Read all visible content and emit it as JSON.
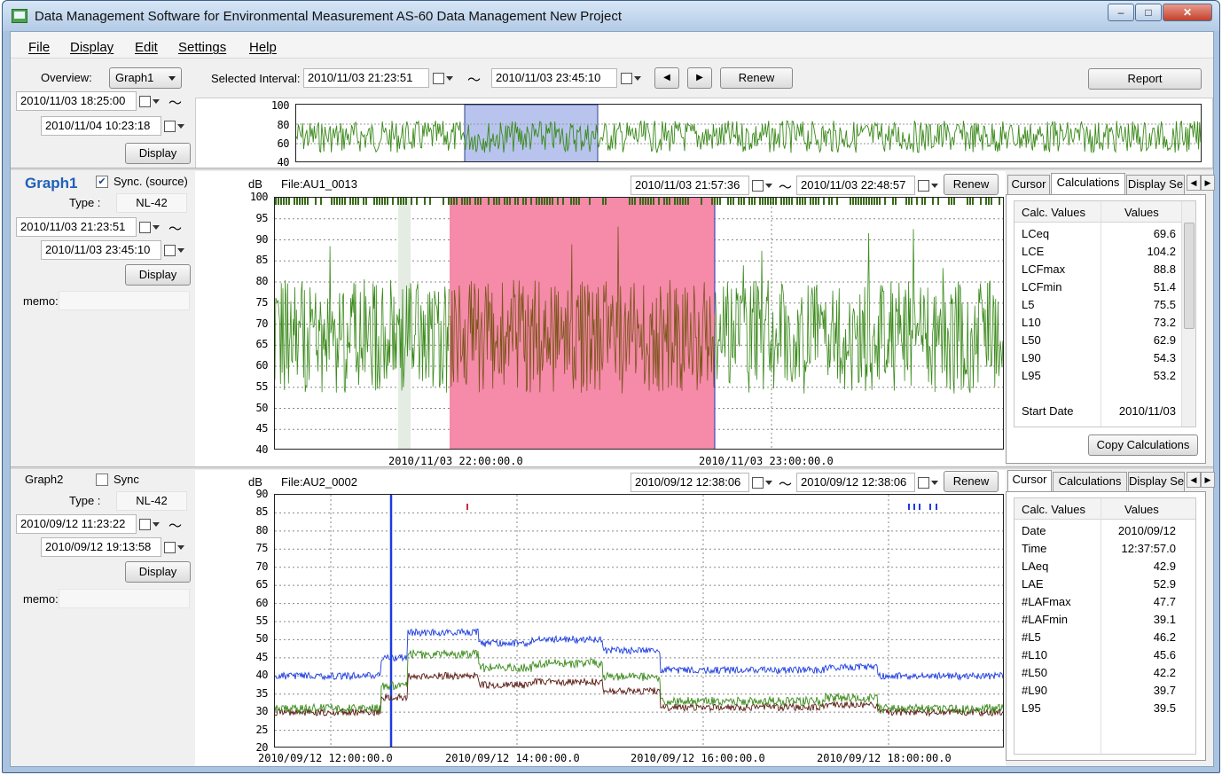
{
  "window": {
    "title": "Data Management Software for Environmental Measurement AS-60 Data Management New Project",
    "min": "‒",
    "max": "□",
    "close": "✕"
  },
  "menu": [
    "File",
    "Display",
    "Edit",
    "Settings",
    "Help"
  ],
  "toolbar": {
    "overview_label": "Overview:",
    "overview_value": "Graph1",
    "selected_interval_label": "Selected Interval:",
    "interval_start": "2010/11/03 21:23:51",
    "interval_end": "2010/11/03 23:45:10",
    "tilde": "〜",
    "prev_icon": "◀",
    "next_icon": "▶",
    "renew": "Renew",
    "report": "Report"
  },
  "overview": {
    "start": "2010/11/03 18:25:00",
    "end": "2010/11/04 10:23:18",
    "display": "Display",
    "yticks": [
      "100",
      "80",
      "60",
      "40"
    ],
    "color_series": "#3a8a1a",
    "color_selection": "#b8c4ee"
  },
  "graph1": {
    "title": "Graph1",
    "sync_label": "Sync. (source)",
    "sync_checked": "✔",
    "type_label": "Type :",
    "type_value": "NL-42",
    "start": "2010/11/03 21:23:51",
    "end": "2010/11/03 23:45:10",
    "display": "Display",
    "memo_label": "memo:",
    "unit": "dB",
    "file": "File:AU1_0013",
    "range_start": "2010/11/03 21:57:36",
    "range_end": "2010/11/03 22:48:57",
    "renew": "Renew",
    "yticks": [
      "100",
      "95",
      "90",
      "85",
      "80",
      "75",
      "70",
      "65",
      "60",
      "55",
      "50",
      "45",
      "40"
    ],
    "xticks": [
      "2010/11/03 22:00:00.0",
      "2010/11/03 23:00:00.0"
    ],
    "colors": {
      "series": "#3a8a1a",
      "selected_series": "#7a5418",
      "highlight": "#f58aa9"
    }
  },
  "graph2": {
    "title": "Graph2",
    "sync_label": "Sync",
    "type_label": "Type :",
    "type_value": "NL-42",
    "start": "2010/09/12 11:23:22",
    "end": "2010/09/12 19:13:58",
    "display": "Display",
    "memo_label": "memo:",
    "unit": "dB",
    "file": "File:AU2_0002",
    "range_start": "2010/09/12 12:38:06",
    "range_end": "2010/09/12 12:38:06",
    "renew": "Renew",
    "yticks": [
      "90",
      "85",
      "80",
      "75",
      "70",
      "65",
      "60",
      "55",
      "50",
      "45",
      "40",
      "35",
      "30",
      "25",
      "20"
    ],
    "xticks": [
      "2010/09/12 12:00:00.0",
      "2010/09/12 14:00:00.0",
      "2010/09/12 16:00:00.0",
      "2010/09/12 18:00:00.0"
    ],
    "colors": {
      "series_a": "#1c3ce0",
      "series_b": "#3a8a1a",
      "series_c": "#5a1a12",
      "marker": "#1c3ce0"
    }
  },
  "calc1": {
    "tabs": [
      "Cursor",
      "Calculations",
      "Display Se"
    ],
    "head_name": "Calc. Values",
    "head_value": "Values",
    "rows": [
      [
        "LCeq",
        "69.6"
      ],
      [
        "LCE",
        "104.2"
      ],
      [
        "LCFmax",
        "88.8"
      ],
      [
        "LCFmin",
        "51.4"
      ],
      [
        "L5",
        "75.5"
      ],
      [
        "L10",
        "73.2"
      ],
      [
        "L50",
        "62.9"
      ],
      [
        "L90",
        "54.3"
      ],
      [
        "L95",
        "53.2"
      ],
      [
        "",
        ""
      ],
      [
        "Start Date",
        "2010/11/03"
      ]
    ],
    "copy": "Copy Calculations"
  },
  "calc2": {
    "tabs": [
      "Cursor",
      "Calculations",
      "Display Se"
    ],
    "head_name": "Calc. Values",
    "head_value": "Values",
    "rows": [
      [
        "Date",
        "2010/09/12"
      ],
      [
        "Time",
        "12:37:57.0"
      ],
      [
        "LAeq",
        "42.9"
      ],
      [
        "LAE",
        "52.9"
      ],
      [
        "#LAFmax",
        "47.7"
      ],
      [
        "#LAFmin",
        "39.1"
      ],
      [
        "#L5",
        "46.2"
      ],
      [
        "#L10",
        "45.6"
      ],
      [
        "#L50",
        "42.2"
      ],
      [
        "#L90",
        "39.7"
      ],
      [
        "L95",
        "39.5"
      ]
    ]
  }
}
